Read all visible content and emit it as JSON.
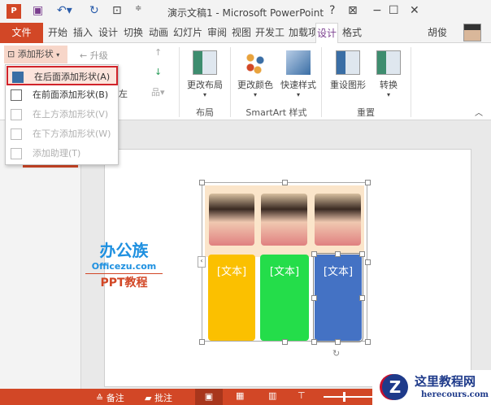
{
  "window": {
    "title": "演示文稿1 - Microsoft PowerPoint",
    "help": "?",
    "minimize": "−",
    "maximize": "☐",
    "close": "✕"
  },
  "tabs": [
    {
      "label": "文件"
    },
    {
      "label": "开始"
    },
    {
      "label": "插入"
    },
    {
      "label": "设计"
    },
    {
      "label": "切换"
    },
    {
      "label": "动画"
    },
    {
      "label": "幻灯片"
    },
    {
      "label": "审阅"
    },
    {
      "label": "视图"
    },
    {
      "label": "开发工"
    },
    {
      "label": "加载项"
    },
    {
      "label": "设计"
    },
    {
      "label": "格式"
    }
  ],
  "user": {
    "name": "胡俊"
  },
  "ribbon": {
    "add_shape": "添加形状",
    "promote": "← 升级",
    "left": "左",
    "change_layout": "更改布局",
    "change_colors": "更改颜色",
    "quick_styles": "快速样式",
    "reset_graphic": "重设图形",
    "convert": "转换",
    "groups": {
      "layout": "布局",
      "smartart_styles": "SmartArt 样式",
      "reset": "重置"
    }
  },
  "menu": [
    {
      "label": "在后面添加形状(A)",
      "enabled": true,
      "highlighted": true
    },
    {
      "label": "在前面添加形状(B)",
      "enabled": true
    },
    {
      "label": "在上方添加形状(V)",
      "enabled": false
    },
    {
      "label": "在下方添加形状(W)",
      "enabled": false
    },
    {
      "label": "添加助理(T)",
      "enabled": false
    }
  ],
  "slide": {
    "watermark": {
      "brand": "办公族",
      "site": "Officezu.com",
      "tag": "PPT教程"
    },
    "columns": [
      {
        "text": "[文本]",
        "color": "#fbc000"
      },
      {
        "text": "[文本]",
        "color": "#24dd4a"
      },
      {
        "text": "[文本]",
        "color": "#4472c4"
      }
    ]
  },
  "status": {
    "notes": "≙ 备注",
    "comments": "批注"
  },
  "corner_logo": {
    "name": "这里教程网",
    "url": "herecours.com"
  }
}
